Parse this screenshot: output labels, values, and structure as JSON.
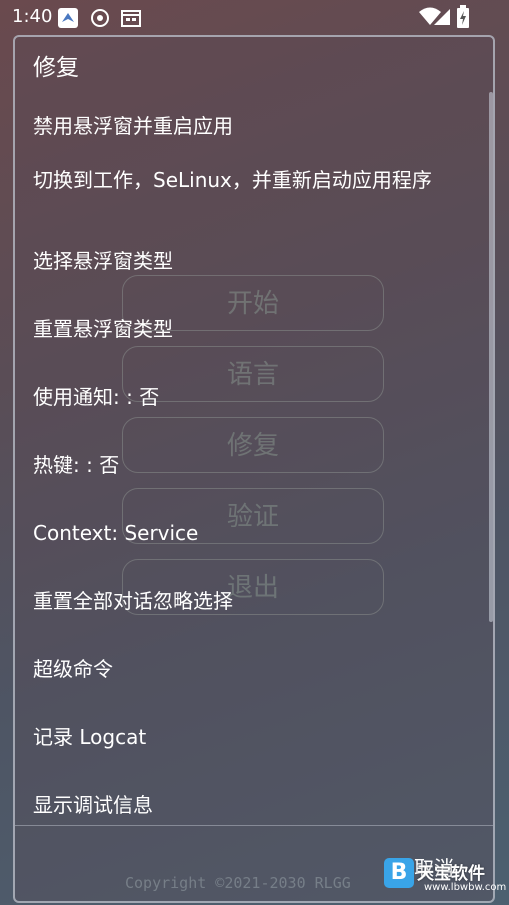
{
  "status_bar": {
    "time": "1:40"
  },
  "background_buttons": [
    "开始",
    "语言",
    "修复",
    "验证",
    "退出"
  ],
  "dialog": {
    "title": "修复",
    "items": [
      "禁用悬浮窗并重启应用",
      "切换到工作，SeLinux，并重新启动应用程序",
      "选择悬浮窗类型",
      "重置悬浮窗类型",
      "使用通知: : 否",
      "热键: : 否",
      "Context: Service",
      "重置全部对话忽略选择",
      "超级命令",
      "记录 Logcat",
      "显示调试信息"
    ],
    "cancel_label": "取消"
  },
  "footer": {
    "copyright": "Copyright ©2021-2030 RLGG"
  },
  "watermark": {
    "logo_letter": "B",
    "text": "天宝软件",
    "url": "www.lbwbw.com"
  }
}
